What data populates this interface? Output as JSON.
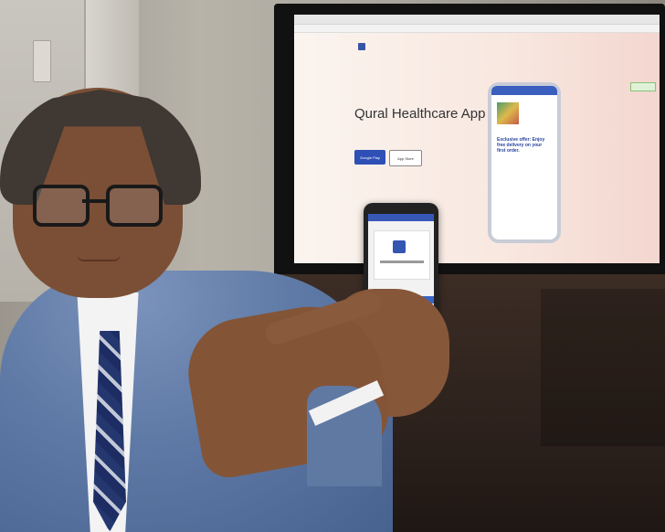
{
  "scene": {
    "description_visible_text": {
      "website_title": "Qural Healthcare App",
      "google_play_label": "Google Play",
      "app_store_label": "App Store",
      "phone_screen_offer": "Exclusive offer: Enjoy free delivery on your first order."
    }
  }
}
